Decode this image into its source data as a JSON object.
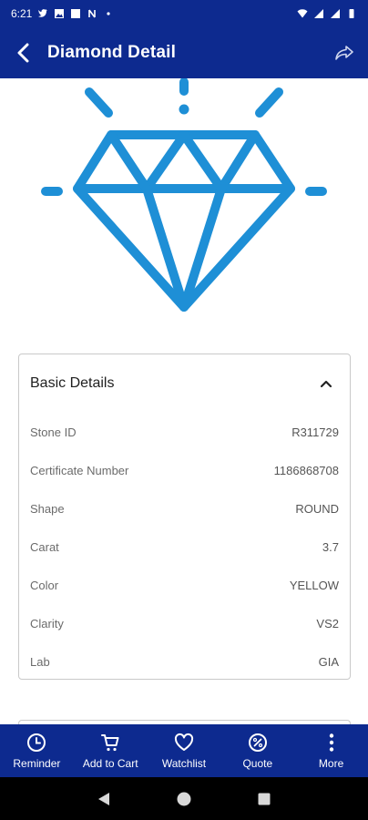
{
  "status_bar": {
    "time": "6:21"
  },
  "app_bar": {
    "title": "Diamond Detail"
  },
  "details": {
    "title": "Basic Details",
    "rows": [
      {
        "label": "Stone ID",
        "value": "R311729"
      },
      {
        "label": "Certificate Number",
        "value": "1186868708"
      },
      {
        "label": "Shape",
        "value": "ROUND"
      },
      {
        "label": "Carat",
        "value": "3.7"
      },
      {
        "label": "Color",
        "value": "YELLOW"
      },
      {
        "label": "Clarity",
        "value": "VS2"
      },
      {
        "label": "Lab",
        "value": "GIA"
      }
    ]
  },
  "bottom_bar": {
    "tabs": [
      {
        "label": "Reminder",
        "icon": "clock-icon"
      },
      {
        "label": "Add to Cart",
        "icon": "cart-icon"
      },
      {
        "label": "Watchlist",
        "icon": "heart-icon"
      },
      {
        "label": "Quote",
        "icon": "percent-badge-icon"
      },
      {
        "label": "More",
        "icon": "more-vertical-icon"
      }
    ]
  },
  "colors": {
    "primary_navy": "#0d2a8f",
    "diamond_blue": "#1e8fd6"
  }
}
